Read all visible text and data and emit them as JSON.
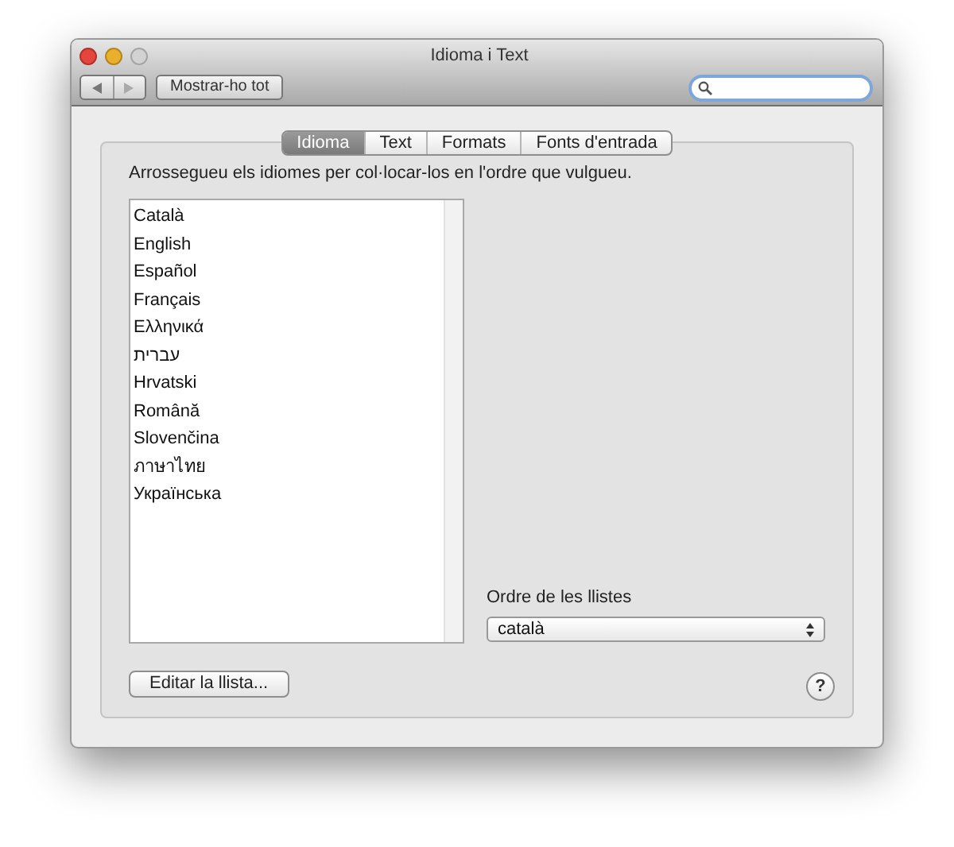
{
  "window": {
    "title": "Idioma i Text"
  },
  "toolbar": {
    "show_all_button": "Mostrar-ho tot"
  },
  "tabs": [
    {
      "label": "Idioma",
      "selected": true
    },
    {
      "label": "Text",
      "selected": false
    },
    {
      "label": "Formats",
      "selected": false
    },
    {
      "label": "Fonts d'entrada",
      "selected": false
    }
  ],
  "instruction": "Arrossegueu els idiomes per col·locar-los en l'ordre que vulgueu.",
  "languages": [
    "Català",
    "English",
    "Español",
    "Français",
    "Ελληνικά",
    "עברית",
    "Hrvatski",
    "Română",
    "Slovenčina",
    "ภาษาไทย",
    "Українська"
  ],
  "list_order": {
    "label": "Ordre de les llistes",
    "value": "català"
  },
  "edit_button": "Editar la llista...",
  "help_button": "?"
}
